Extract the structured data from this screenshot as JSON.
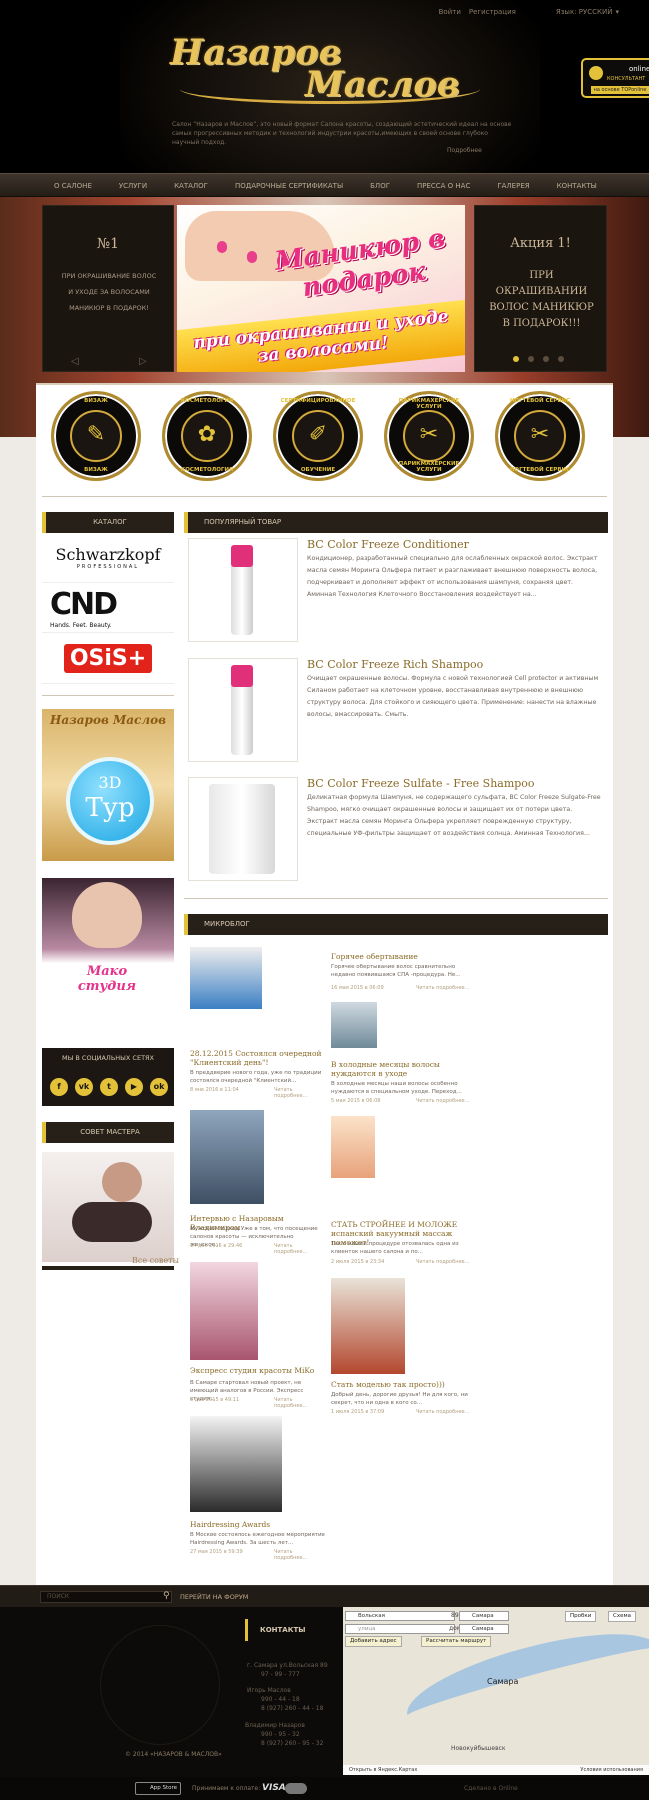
{
  "header": {
    "top_links": [
      "Войти",
      "Регистрация"
    ],
    "lang_label": "Язык: РУССКИЙ",
    "logo_line1": "Назаров",
    "logo_line2": "Маслов",
    "intro": "Салон “Назаров и Маслов”, это новый формат Салона красоты, создающий эстетический идеал на основе самых прогрессивных методик и технологий индустрии красоты,имеющих в своей основе глубоко научный подход.",
    "more_link": "Подробнее",
    "online": {
      "title": "online",
      "subtitle": "КОНСУЛЬТАНТ",
      "bar": "на основе TOPonline"
    }
  },
  "nav": {
    "items": [
      "О САЛОНЕ",
      "УСЛУГИ",
      "КАТАЛОГ",
      "ПОДАРОЧНЫЕ СЕРТИФИКАТЫ",
      "БЛОГ",
      "ПРЕССА О НАС",
      "ГАЛЕРЕЯ",
      "КОНТАКТЫ"
    ]
  },
  "slider": {
    "left_number": "№1",
    "left_lines": [
      "ПРИ ОКРАШИВАНИЕ ВОЛОС",
      "И УХОДЕ ЗА ВОЛОСАМИ",
      "МАНИКЮР В ПОДАРОК!"
    ],
    "main_heading": "Маникюр в подарок",
    "main_sub": "при окрашивании и уходе за волосами!",
    "right_title": "Акция 1!",
    "right_text": "ПРИ ОКРАШИВАНИИ ВОЛОС МАНИКЮР В ПОДАРОК!!!",
    "arrow_prev": "◁",
    "arrow_next": "▷"
  },
  "services": [
    {
      "top": "ВИЗАЖ",
      "bottom": "ВИЗАЖ",
      "icon": "makeup-icon",
      "glyph": "✎"
    },
    {
      "top": "КОСМЕТОЛОГИЯ",
      "bottom": "КОСМЕТОЛОГИЯ",
      "icon": "cosmetology-icon",
      "glyph": "✿"
    },
    {
      "top": "СЕРТИФИЦИРОВАННОЕ",
      "bottom": "ОБУЧЕНИЕ",
      "icon": "training-icon",
      "glyph": "✐"
    },
    {
      "top": "ПАРИКМАХЕРСКИЕ УСЛУГИ",
      "bottom": "ПАРИКМАХЕРСКИЕ УСЛУГИ",
      "icon": "scissors-icon",
      "glyph": "✂"
    },
    {
      "top": "НОГТЕВОЙ СЕРВИС",
      "bottom": "НОГТЕВОЙ СЕРВИС",
      "icon": "nail-icon",
      "glyph": "✂"
    }
  ],
  "sidebar": {
    "catalog_title": "КАТАЛОГ",
    "brands": [
      {
        "name": "Schwarzkopf",
        "sub": "PROFESSIONAL"
      },
      {
        "name": "CND",
        "sub": "Hands. Feet. Beauty."
      },
      {
        "name": "OSiS+",
        "sub": ""
      }
    ],
    "tour": {
      "logo": "Назаров Маслов",
      "label3d": "3D",
      "label": "Тур"
    },
    "mako": "Мако студия",
    "social_title": "МЫ В СОЦИАЛЬНЫХ СЕТЯХ",
    "social_icons": [
      {
        "name": "facebook-icon",
        "glyph": "f"
      },
      {
        "name": "vk-icon",
        "glyph": "vk"
      },
      {
        "name": "twitter-icon",
        "glyph": "t"
      },
      {
        "name": "youtube-icon",
        "glyph": "▶"
      },
      {
        "name": "odnoklassniki-icon",
        "glyph": "ok"
      }
    ],
    "master_title": "СОВЕТ МАСТЕРА",
    "all_tips": "Все советы"
  },
  "products": {
    "title": "ПОПУЛЯРНЫЙ ТОВАР",
    "items": [
      {
        "name": "BC Color Freeze Conditioner",
        "desc": "Кондиционер, разработанный специально для ослабленных окраской волос. Экстракт масла семян Моринга Ольфера питает и разглаживает внешнюю поверхность волоса, подчеркивает и дополняет эффект от использования шампуня, сохраняя цвет. Аминная Технология Клеточного Восстановления воздействует на..."
      },
      {
        "name": "BC Color Freeze Rich Shampoo",
        "desc": "Очищает окрашенные волосы. Формула с новой технологией Cell protector и активным Силаном работает на клеточном уровне, восстанавливая внутреннюю и внешнюю структуру волоса. Для стойкого и сияющего цвета. Применение: нанести на влажные волосы, вмассировать. Смыть."
      },
      {
        "name": "BC Color Freeze Sulfate - Free Shampoo",
        "desc": "Деликатная формула Шампуня, не содержащего сульфата, BC Color Freeze Sulgate-Free Shampoo, мягко очищает окрашенные волосы и защищает их от потери цвета. Экстракт масла семян Моринга Ольфера укрепляет поврежденную структуру, специальные УФ-фильтры защищает от воздействия солнца. Аминная Технология..."
      }
    ]
  },
  "blog": {
    "title": "МИКРОБЛОГ",
    "more": "Читать подробнее...",
    "posts": [
      {
        "title": "Горячее обертывание",
        "text": "Горячее обертывание волос сравнительно недавно появившаяся СПА -процедура. Не...",
        "date": "16 мая 2015 в 06:09"
      },
      {
        "title": "28.12.2015 Состоялся очередной \"Клиентский день\"!",
        "text": "В преддверие нового года, уже по традиции состоялся очередной \"Клиентский...",
        "date": "8 янв 2016 в 11:04"
      },
      {
        "title": "В холодные месяцы волосы нуждаются в уходе",
        "text": "В холодные месяцы наши волосы особенно нуждаются в специальном уходе. Переход...",
        "date": "5 мая 2015 в 06:08"
      },
      {
        "title": "Интервью с Назаровым Владимиром",
        "text": "Мужской подход Уже в том, что посещение салонов красоты — исключительно женское...",
        "date": "14 дек 2015 в 29:46"
      },
      {
        "title": "СТАТЬ СТРОЙНЕЕ И МОЛОЖЕ испанский вакуумный массаж поможет!",
        "text": "Так о нашей процедуре отозвалась одна из клиенток нашего салона и по...",
        "date": "2 июля 2015 в 23:34"
      },
      {
        "title": "Экспресс студия красоты MiKo",
        "text": "В Самаре стартовал новый проект, не имеющий аналогов в России. Экспресс студия...",
        "date": "8 дек 2015 в 49:11"
      },
      {
        "title": "Стать моделью так просто)))",
        "text": "Добрый день, дорогие друзья! Ни для кого, ни секрет, что ни одна в кого со...",
        "date": "1 июля 2015 в 37:09"
      },
      {
        "title": "Hairdressing Awards",
        "text": "В Москве состоялось ежегодное мероприятие Hairdressing Awards. За шесть лет...",
        "date": "27 мая 2015 в 59:39"
      }
    ]
  },
  "footer": {
    "search_placeholder": "ПОИСК",
    "forum_link": "ПЕРЕЙТИ НА ФОРУМ",
    "contacts_title": "КОНТАКТЫ",
    "contact_lines": [
      "г. Самара ул.Вольская 89",
      "97 - 99 - 777",
      "Игорь Маслов",
      "990 - 44 - 18",
      "8 (927) 260 - 44 - 18",
      "Владимир Назаров",
      "990 - 95 - 32",
      "8 (927) 260 - 95 - 32"
    ],
    "copyright": "© 2014 «НАЗАРОВ & МАСЛОВ»",
    "map": {
      "from": "Вольская",
      "from_num": "89",
      "from_city": "Самара",
      "to_placeholder": "улица",
      "to_num": "дом",
      "to_city": "Самара",
      "traffic": "Пробки",
      "scheme": "Схема",
      "add_address": "Добавить адрес",
      "route": "Рассчитать маршрут",
      "city_label": "Самара",
      "district": "Новокуйбышевск",
      "open_link": "Открыть в Яндекс.Картах",
      "terms": "Условия использования"
    },
    "app_store": "App Store",
    "pay_label": "Принимаем к оплате:",
    "visa": "VISA",
    "mastercard": "MasterCard",
    "made_in": "Сделано в Online"
  }
}
